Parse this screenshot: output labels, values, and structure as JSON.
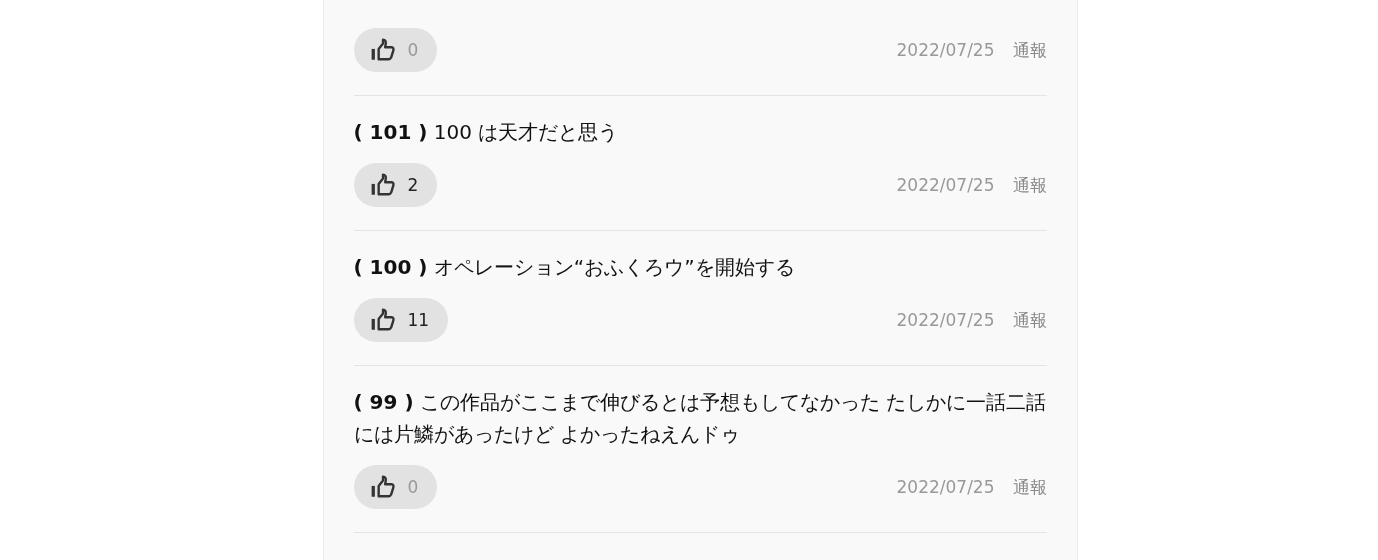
{
  "comments": [
    {
      "likes": "0",
      "has_likes": false,
      "date": "2022/07/25",
      "report": "通報"
    },
    {
      "number": "( 101 )",
      "text": "100 は天才だと思う",
      "likes": "2",
      "has_likes": true,
      "date": "2022/07/25",
      "report": "通報"
    },
    {
      "number": "( 100 )",
      "text": "オペレーション“おふくろウ”を開始する",
      "likes": "11",
      "has_likes": true,
      "date": "2022/07/25",
      "report": "通報"
    },
    {
      "number": "( 99 )",
      "text": "この作品がここまで伸びるとは予想もしてなかった たしかに一話二話には片鱗があったけど よかったねえんドゥ",
      "likes": "0",
      "has_likes": false,
      "date": "2022/07/25",
      "report": "通報"
    }
  ]
}
